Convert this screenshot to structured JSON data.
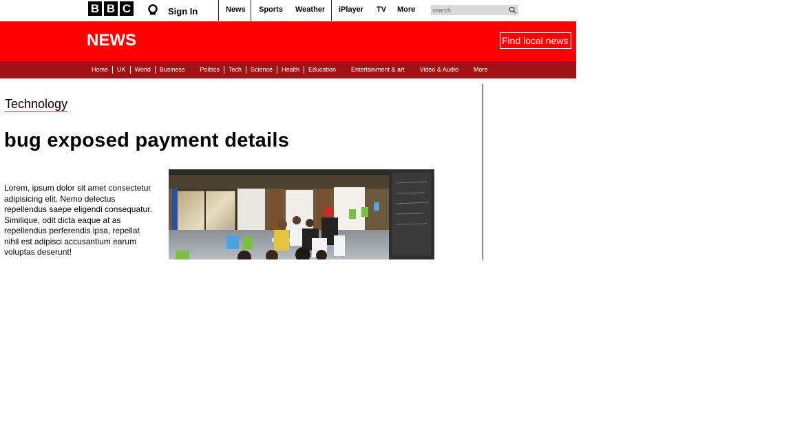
{
  "header": {
    "logo_letters": [
      "B",
      "B",
      "C"
    ],
    "signin_label": "Sign In",
    "nav": [
      "News",
      "Sports",
      "Weather",
      "iPlayer",
      "TV",
      "More"
    ],
    "search_placeholder": "search"
  },
  "newsbar": {
    "title": "NEWS",
    "find_local": "Find local news"
  },
  "subnav": [
    "Home",
    "UK",
    "World",
    "Business",
    "Politics",
    "Tech",
    "Science",
    "Health",
    "Education",
    "Entertainment & art",
    "Video & Audio",
    "More"
  ],
  "article": {
    "section": "Technology",
    "headline": "bug exposed payment details",
    "body": "Lorem, ipsum dolor sit amet consectetur adipisicing elit. Nemo delectus repellendus saepe eligendi consequatur. Similique, odit dicta eaque at as repellendus perferendis ipsa, repellat nihil est adipisci accusantium earum voluptas deserunt!"
  },
  "colors": {
    "brand_red": "#ff0000",
    "subnav_red": "#a31212"
  }
}
